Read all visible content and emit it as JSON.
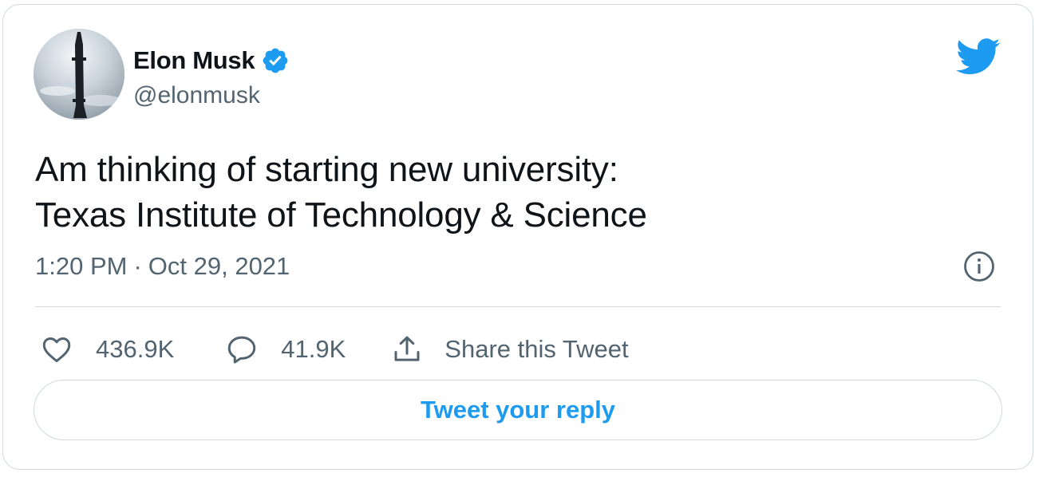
{
  "tweet": {
    "author": {
      "name": "Elon Musk",
      "handle": "@elonmusk",
      "verified": true,
      "avatar_icon": "starship-avatar"
    },
    "text": "Am thinking of starting new university:\nTexas Institute of Technology & Science",
    "time": "1:20 PM",
    "separator": "·",
    "date": "Oct 29, 2021",
    "likes": "436.9K",
    "replies": "41.9K",
    "share_label": "Share this Tweet",
    "reply_button_label": "Tweet your reply"
  },
  "icons": {
    "brand": "twitter-bird-icon",
    "verified": "verified-badge-icon",
    "info": "info-icon",
    "like": "heart-icon",
    "reply": "speech-bubble-icon",
    "share": "share-upload-icon"
  },
  "colors": {
    "brand": "#1d9bf0",
    "text": "#0f1419",
    "secondary": "#536471",
    "border": "#cfd9de"
  }
}
